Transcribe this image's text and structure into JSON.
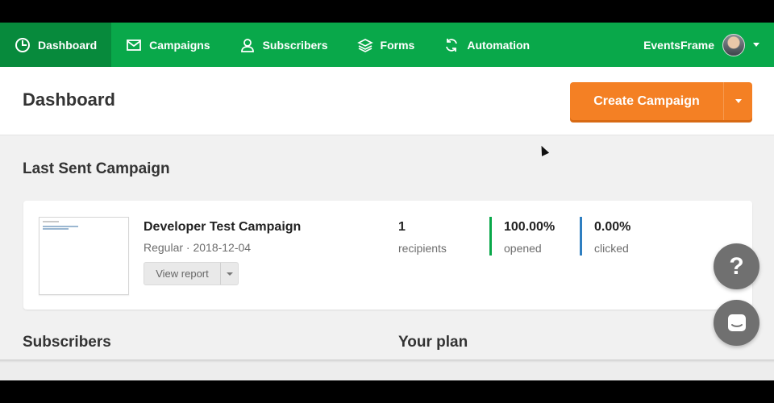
{
  "nav": {
    "items": [
      {
        "label": "Dashboard",
        "icon": "dashboard-icon",
        "active": true
      },
      {
        "label": "Campaigns",
        "icon": "envelope-icon"
      },
      {
        "label": "Subscribers",
        "icon": "user-icon"
      },
      {
        "label": "Forms",
        "icon": "layers-icon"
      },
      {
        "label": "Automation",
        "icon": "refresh-icon"
      }
    ],
    "account_name": "EventsFrame"
  },
  "header": {
    "title": "Dashboard",
    "create_label": "Create Campaign"
  },
  "last_sent": {
    "section_title": "Last Sent Campaign",
    "campaign_name": "Developer Test Campaign",
    "campaign_meta": "Regular · 2018-12-04",
    "view_report_label": "View report",
    "stats": [
      {
        "value": "1",
        "label": "recipients"
      },
      {
        "value": "100.00%",
        "label": "opened",
        "color": "#09a84a"
      },
      {
        "value": "0.00%",
        "label": "clicked",
        "color": "#2f7fc1"
      }
    ]
  },
  "sections": {
    "subscribers_title": "Subscribers",
    "plan_title": "Your plan"
  },
  "help": {
    "help_label": "?"
  },
  "colors": {
    "brand_green": "#09a84a",
    "accent_orange": "#f48024"
  }
}
